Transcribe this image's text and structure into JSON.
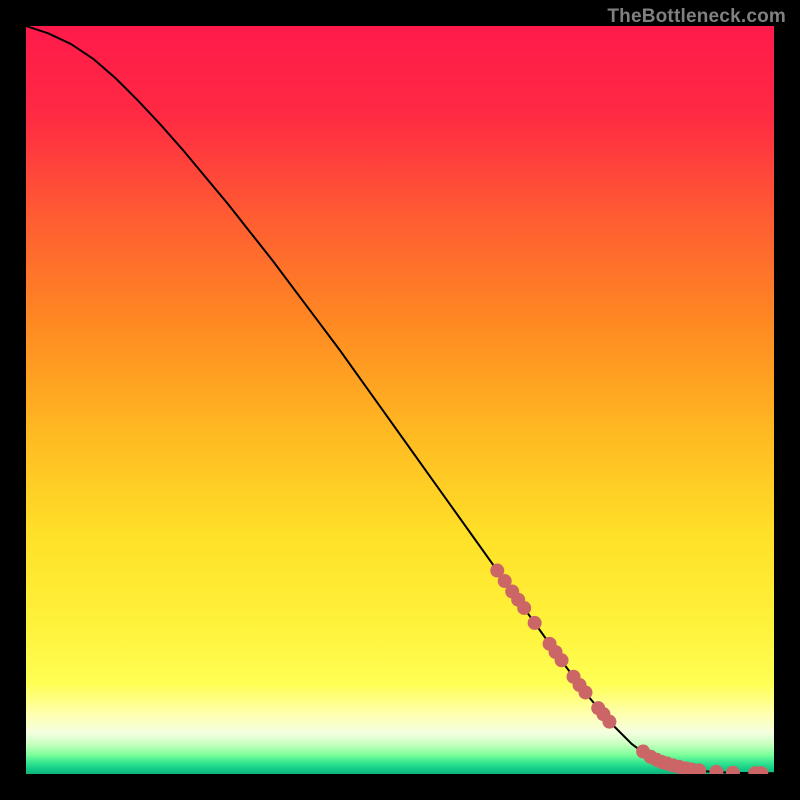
{
  "watermark": "TheBottleneck.com",
  "colors": {
    "gradient_stops": [
      {
        "offset": 0.0,
        "color": "#ff1a4b"
      },
      {
        "offset": 0.12,
        "color": "#ff2a43"
      },
      {
        "offset": 0.25,
        "color": "#ff5a33"
      },
      {
        "offset": 0.4,
        "color": "#ff8a22"
      },
      {
        "offset": 0.55,
        "color": "#ffbb22"
      },
      {
        "offset": 0.68,
        "color": "#ffe028"
      },
      {
        "offset": 0.8,
        "color": "#fff23a"
      },
      {
        "offset": 0.88,
        "color": "#ffff55"
      },
      {
        "offset": 0.92,
        "color": "#ffffb0"
      },
      {
        "offset": 0.945,
        "color": "#f4ffe0"
      },
      {
        "offset": 0.96,
        "color": "#c8ffc0"
      },
      {
        "offset": 0.974,
        "color": "#7fff9a"
      },
      {
        "offset": 0.985,
        "color": "#33e690"
      },
      {
        "offset": 0.993,
        "color": "#15cc88"
      },
      {
        "offset": 1.0,
        "color": "#0fb37a"
      }
    ],
    "curve": "#000000",
    "points": "#cc6666",
    "frame": "#000000"
  },
  "chart_data": {
    "type": "line",
    "title": "",
    "xlabel": "",
    "ylabel": "",
    "xlim": [
      0,
      100
    ],
    "ylim": [
      0,
      100
    ],
    "series": [
      {
        "name": "curve",
        "x": [
          0,
          3,
          6,
          9,
          12,
          15,
          18,
          21,
          24,
          27,
          30,
          33,
          36,
          39,
          42,
          45,
          48,
          51,
          54,
          57,
          60,
          63,
          66,
          69,
          72,
          75,
          78,
          81,
          83,
          85,
          87,
          89,
          91,
          92.5,
          94,
          95.5,
          97,
          98.5,
          100
        ],
        "y": [
          100,
          99.0,
          97.6,
          95.6,
          93.0,
          90.0,
          86.8,
          83.4,
          79.8,
          76.2,
          72.4,
          68.6,
          64.6,
          60.6,
          56.6,
          52.4,
          48.2,
          44.0,
          39.8,
          35.6,
          31.4,
          27.2,
          23.0,
          18.8,
          14.6,
          10.6,
          7.0,
          4.0,
          2.5,
          1.6,
          1.0,
          0.6,
          0.35,
          0.25,
          0.18,
          0.14,
          0.12,
          0.11,
          0.1
        ]
      }
    ],
    "scatter_points": [
      {
        "x": 63.0,
        "y": 27.2
      },
      {
        "x": 64.0,
        "y": 25.8
      },
      {
        "x": 65.0,
        "y": 24.4
      },
      {
        "x": 65.8,
        "y": 23.3
      },
      {
        "x": 66.6,
        "y": 22.2
      },
      {
        "x": 68.0,
        "y": 20.2
      },
      {
        "x": 70.0,
        "y": 17.4
      },
      {
        "x": 70.8,
        "y": 16.3
      },
      {
        "x": 71.6,
        "y": 15.2
      },
      {
        "x": 73.2,
        "y": 13.0
      },
      {
        "x": 74.0,
        "y": 11.9
      },
      {
        "x": 74.8,
        "y": 10.9
      },
      {
        "x": 76.5,
        "y": 8.8
      },
      {
        "x": 77.2,
        "y": 8.0
      },
      {
        "x": 78.0,
        "y": 7.0
      },
      {
        "x": 82.5,
        "y": 3.0
      },
      {
        "x": 83.5,
        "y": 2.3
      },
      {
        "x": 84.3,
        "y": 1.9
      },
      {
        "x": 85.0,
        "y": 1.6
      },
      {
        "x": 85.7,
        "y": 1.4
      },
      {
        "x": 86.5,
        "y": 1.15
      },
      {
        "x": 87.3,
        "y": 0.95
      },
      {
        "x": 88.2,
        "y": 0.75
      },
      {
        "x": 89.0,
        "y": 0.6
      },
      {
        "x": 90.0,
        "y": 0.48
      },
      {
        "x": 92.3,
        "y": 0.28
      },
      {
        "x": 94.5,
        "y": 0.17
      },
      {
        "x": 97.5,
        "y": 0.12
      },
      {
        "x": 98.3,
        "y": 0.11
      }
    ]
  }
}
